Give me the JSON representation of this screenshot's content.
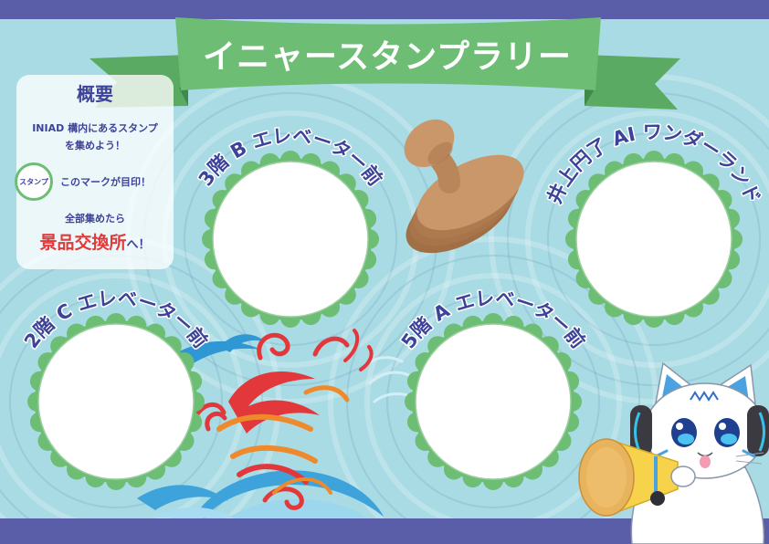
{
  "title": "イニャースタンプラリー",
  "overview": {
    "heading": "概要",
    "line1": "INIAD 構内にあるスタンプ",
    "line2": "を集めよう！",
    "mark_label": "スタンプ",
    "mark_text": "このマークが目印！",
    "line3": "全部集めたら",
    "prize_place": "景品交換所",
    "prize_suffix": "へ！"
  },
  "stamps": [
    {
      "label": "3階 B エレベーター前"
    },
    {
      "label": "井上円了 AI ワンダーランド"
    },
    {
      "label": "2階 C エレベーター前"
    },
    {
      "label": "5階 A エレベーター前"
    }
  ],
  "icons": {
    "rubber_stamp": "rubber-stamp-icon",
    "mascot": "cat-mascot-with-megaphone",
    "decoration": "fire-and-water-decoration",
    "stamp_mark": "stamp-mark-icon"
  },
  "colors": {
    "background": "#a9dbe5",
    "band": "#5a5ea8",
    "ribbon": "#6dbe74",
    "ribbon_dark": "#5aaa63",
    "text": "#3d4398",
    "accent_red": "#e03a3a",
    "frame": "#6dbe74"
  }
}
